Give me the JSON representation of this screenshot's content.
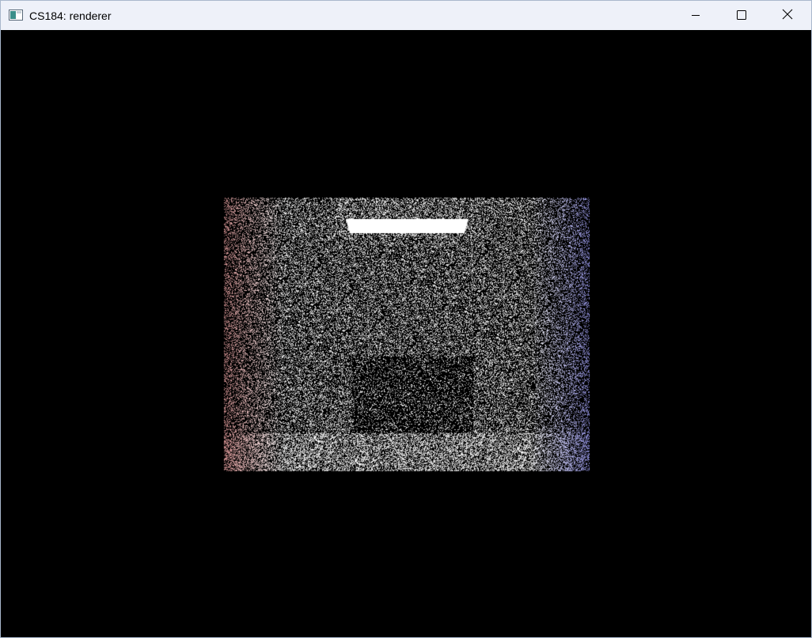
{
  "window": {
    "title": "CS184: renderer"
  },
  "icons": {
    "app": "application-window-icon",
    "minimize": "minimize-icon",
    "maximize": "maximize-icon",
    "close": "close-icon"
  },
  "colors": {
    "titlebar_bg": "#eef1f9",
    "viewport_bg": "#000000",
    "light_color": "#ffffff",
    "left_wall_tint": "#e8a0a0",
    "right_wall_tint": "#9a9af0"
  }
}
